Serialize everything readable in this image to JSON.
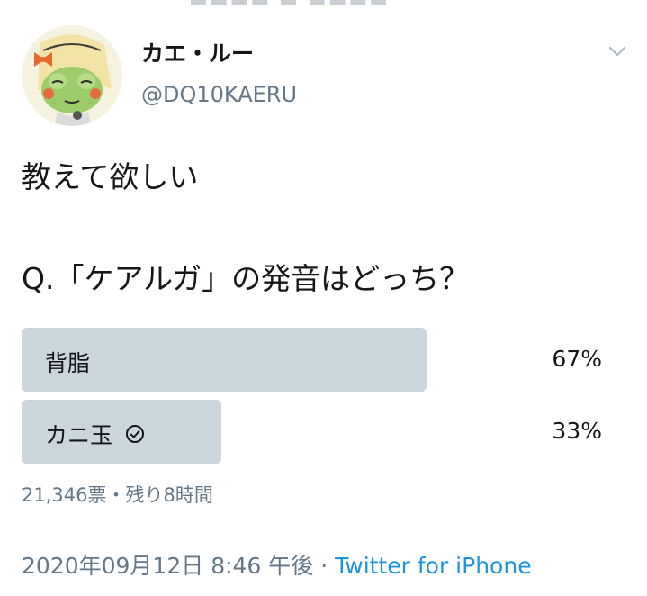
{
  "user": {
    "display_name": "カエ・ルー",
    "handle": "@DQ10KAERU"
  },
  "tweet": {
    "line1": "教えて欲しい",
    "line2": "Q.「ケアルガ」の発音はどっち？"
  },
  "poll": {
    "options": [
      {
        "label": "背脂",
        "percent_text": "67%",
        "percent": 67,
        "selected": false
      },
      {
        "label": "カニ玉",
        "percent_text": "33%",
        "percent": 33,
        "selected": true
      }
    ],
    "meta": "21,346票・残り8時間"
  },
  "footer": {
    "timestamp": "2020年09月12日 8:46 午後",
    "separator": " · ",
    "source": "Twitter for iPhone"
  },
  "colors": {
    "bar": "#ccd6dd",
    "secondary_text": "#657786",
    "link": "#1b95e0"
  },
  "icons": {
    "avatar": "frog-character-avatar",
    "caret": "chevron-down-icon",
    "check": "check-circle-icon"
  }
}
